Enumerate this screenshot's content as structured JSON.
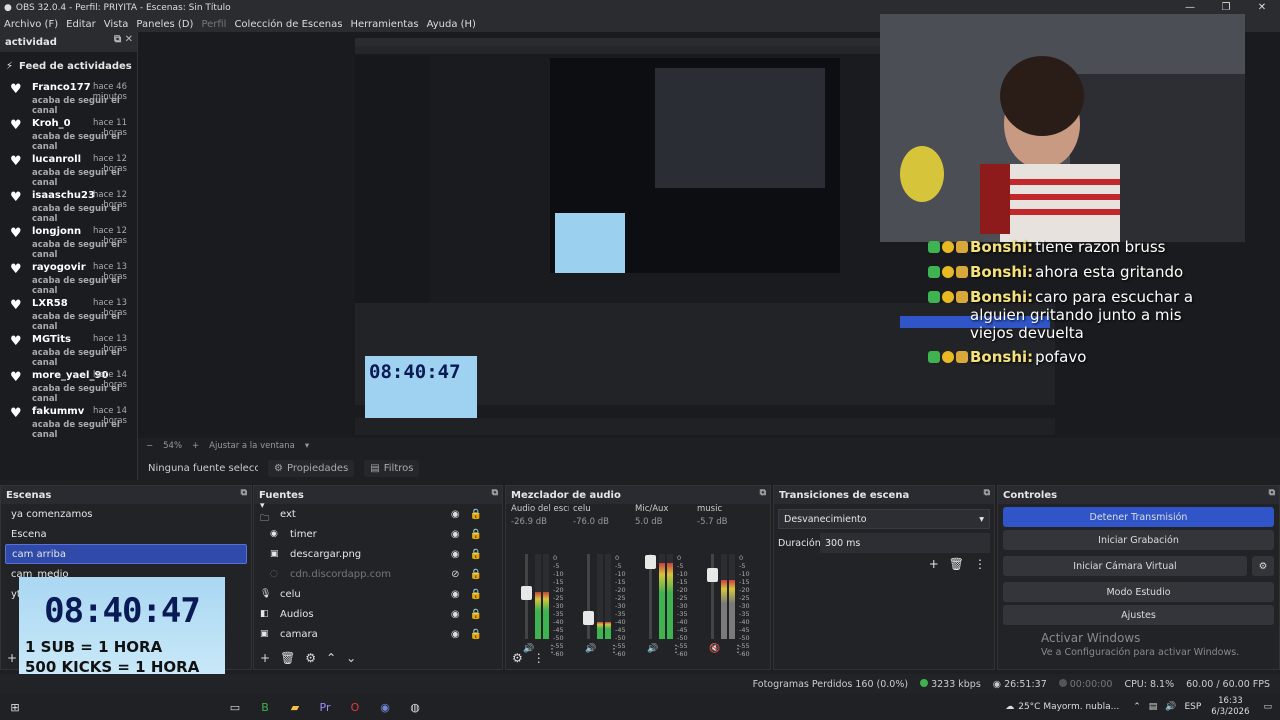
{
  "window": {
    "title": "OBS 32.0.4 - Perfil: PRIYITA - Escenas: Sin Título"
  },
  "menu": [
    "Archivo (F)",
    "Editar",
    "Vista",
    "Paneles (D)",
    "Perfil",
    "Colección de Escenas",
    "Herramientas",
    "Ayuda (H)"
  ],
  "activity": {
    "dock_title": "actividad",
    "feed_title": "Feed de actividades",
    "items": [
      {
        "name": "Franco177",
        "time": "hace 46 minutos",
        "msg": "acaba de seguir el canal"
      },
      {
        "name": "Kroh_0",
        "time": "hace 11 horas",
        "msg": "acaba de seguir el canal"
      },
      {
        "name": "lucanroll",
        "time": "hace 12 horas",
        "msg": "acaba de seguir el canal"
      },
      {
        "name": "isaaschu23",
        "time": "hace 12 horas",
        "msg": "acaba de seguir el canal"
      },
      {
        "name": "longjonn",
        "time": "hace 12 horas",
        "msg": "acaba de seguir el canal"
      },
      {
        "name": "rayogovir",
        "time": "hace 13 horas",
        "msg": "acaba de seguir el canal"
      },
      {
        "name": "LXR58",
        "time": "hace 13 horas",
        "msg": "acaba de seguir el canal"
      },
      {
        "name": "MGTits",
        "time": "hace 13 horas",
        "msg": "acaba de seguir el canal"
      },
      {
        "name": "more_yael_90",
        "time": "hace 14 horas",
        "msg": "acaba de seguir el canal"
      },
      {
        "name": "fakummv",
        "time": "hace 14 horas",
        "msg": "acaba de seguir el canal"
      }
    ]
  },
  "chat": [
    {
      "user": "Bonshi:",
      "text": "tiene razon bruss"
    },
    {
      "user": "Bonshi:",
      "text": "ahora esta gritando"
    },
    {
      "user": "Bonshi:",
      "text": "caro para escuchar a alguien gritando junto a mis viejos devuelta"
    },
    {
      "user": "Bonshi:",
      "text": "pofavo"
    }
  ],
  "preview": {
    "zoom": "54%",
    "fit": "Ajustar a la ventana"
  },
  "sourcebar": {
    "no_source": "Ninguna fuente seleccionada",
    "properties": "Propiedades",
    "filters": "Filtros"
  },
  "scenes": {
    "title": "Escenas",
    "items": [
      "ya comenzamos",
      "Escena",
      "cam arriba",
      "cam_medio",
      "yt"
    ],
    "selected": 2
  },
  "sources": {
    "title": "Fuentes",
    "items": [
      {
        "name": "ext",
        "icon": "folder-icon",
        "indent": 0
      },
      {
        "name": "timer",
        "icon": "text-icon",
        "indent": 1
      },
      {
        "name": "descargar.png",
        "icon": "image-icon",
        "indent": 1
      },
      {
        "name": "cdn.discordapp.com",
        "icon": "browser-icon",
        "indent": 1,
        "hidden": true
      },
      {
        "name": "celu",
        "icon": "mic-icon",
        "indent": 0
      },
      {
        "name": "Audios",
        "icon": "media-icon",
        "indent": 0
      },
      {
        "name": "camara",
        "icon": "camera-icon",
        "indent": 0
      }
    ]
  },
  "mixer": {
    "title": "Mezclador de audio",
    "channels": [
      {
        "name": "Audio del escritorio",
        "db": "-26.9 dB",
        "level": 0.55,
        "fader": 0.55,
        "color": "#3fb34f",
        "muted": false
      },
      {
        "name": "celu",
        "db": "-76.0 dB",
        "level": 0.2,
        "fader": 0.2,
        "color": "#3fb34f",
        "muted": false
      },
      {
        "name": "Mic/Aux",
        "db": "5.0 dB",
        "level": 0.9,
        "fader": 0.98,
        "color": "#3fb34f",
        "muted": false
      },
      {
        "name": "music",
        "db": "-5.7 dB",
        "level": 0.7,
        "fader": 0.8,
        "color": "#7a7a7a",
        "muted": true
      }
    ],
    "scale": [
      "0",
      "-5",
      "-10",
      "-15",
      "-20",
      "-25",
      "-30",
      "-35",
      "-40",
      "-45",
      "-50",
      "-55",
      "-60"
    ]
  },
  "transitions": {
    "title": "Transiciones de escena",
    "selected": "Desvanecimiento",
    "duration_label": "Duración",
    "duration_value": "300 ms"
  },
  "controls": {
    "title": "Controles",
    "buttons": [
      "Detener Transmisión",
      "Iniciar Grabación",
      "Iniciar Cámara Virtual",
      "Modo Estudio",
      "Ajustes"
    ]
  },
  "watermark": {
    "line1": "Activar Windows",
    "line2": "Ve a Configuración para activar Windows."
  },
  "timer_overlay": {
    "clock": "08:40:47",
    "line1": "1 SUB = 1 HORA",
    "line2": "500 KICKS = 1 HORA"
  },
  "status": {
    "dropped": "Fotogramas Perdidos 160 (0.0%)",
    "bitrate": "3233 kbps",
    "stream_time": "26:51:37",
    "rec_time": "00:00:00",
    "cpu": "CPU: 8.1%",
    "fps": "60.00 / 60.00 FPS"
  },
  "taskbar": {
    "weather": "25°C  Mayorm. nubla...",
    "lang": "ESP",
    "time": "16:33",
    "date": "6/3/2026"
  },
  "colors": {
    "accent": "#2f55c8",
    "selected": "#2f4aa8"
  }
}
